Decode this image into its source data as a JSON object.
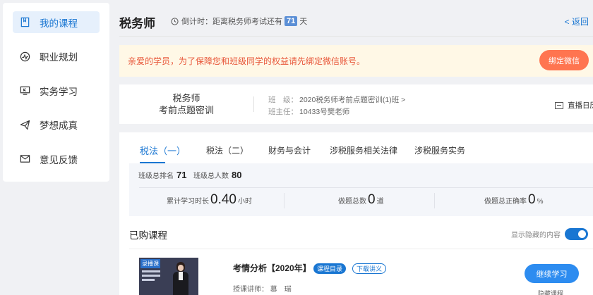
{
  "sidebar": {
    "items": [
      {
        "label": "我的课程",
        "icon": "book-icon"
      },
      {
        "label": "职业规划",
        "icon": "chart-icon"
      },
      {
        "label": "实务学习",
        "icon": "monitor-icon"
      },
      {
        "label": "梦想成真",
        "icon": "paper-plane-icon"
      },
      {
        "label": "意见反馈",
        "icon": "mail-icon"
      }
    ]
  },
  "header": {
    "title": "税务师",
    "countdown_prefix": "倒计时：距离税务师考试还有",
    "countdown_days": "71",
    "countdown_suffix": "天",
    "back_label": "< 返回"
  },
  "notice": {
    "text": "亲爱的学员，为了保障您和班级同学的权益请先绑定微信账号。",
    "button": "绑定微信"
  },
  "class_info": {
    "course_line1": "税务师",
    "course_line2": "考前点题密训",
    "class_label": "班　级：",
    "class_value": "2020税务师考前点题密训(1)班 >",
    "teacher_label": "班主任：",
    "teacher_value": "10433号樊老师",
    "replay_label": "直播日历"
  },
  "tabs": [
    "税法（一）",
    "税法（二）",
    "财务与会计",
    "涉税服务相关法律",
    "涉税服务实务"
  ],
  "stats": {
    "rank_label": "班级总排名",
    "rank_value": "71",
    "total_label": "班级总人数",
    "total_value": "80",
    "study_label": "累计学习时长",
    "study_value": "0.40",
    "study_unit": "小时",
    "questions_label": "做题总数",
    "questions_value": "0",
    "questions_unit": "道",
    "accuracy_label": "做题总正确率",
    "accuracy_value": "0",
    "accuracy_unit": "%"
  },
  "purchased": {
    "title": "已购课程",
    "toggle_label": "显示隐藏的内容",
    "toggle_on": true
  },
  "course": {
    "thumb_tag": "录播课",
    "title": "考情分析【2020年】",
    "catalog_tag": "课程目录",
    "download_tag": "下载讲义",
    "teacher": "授课讲师： 慕　瑞",
    "continue_button": "继续学习",
    "hide_label": "隐藏课程"
  },
  "colors": {
    "accent": "#1976d2",
    "notice_bg": "#fff8e6",
    "notice_text": "#e8573a",
    "bind_button": "#ff7550"
  }
}
